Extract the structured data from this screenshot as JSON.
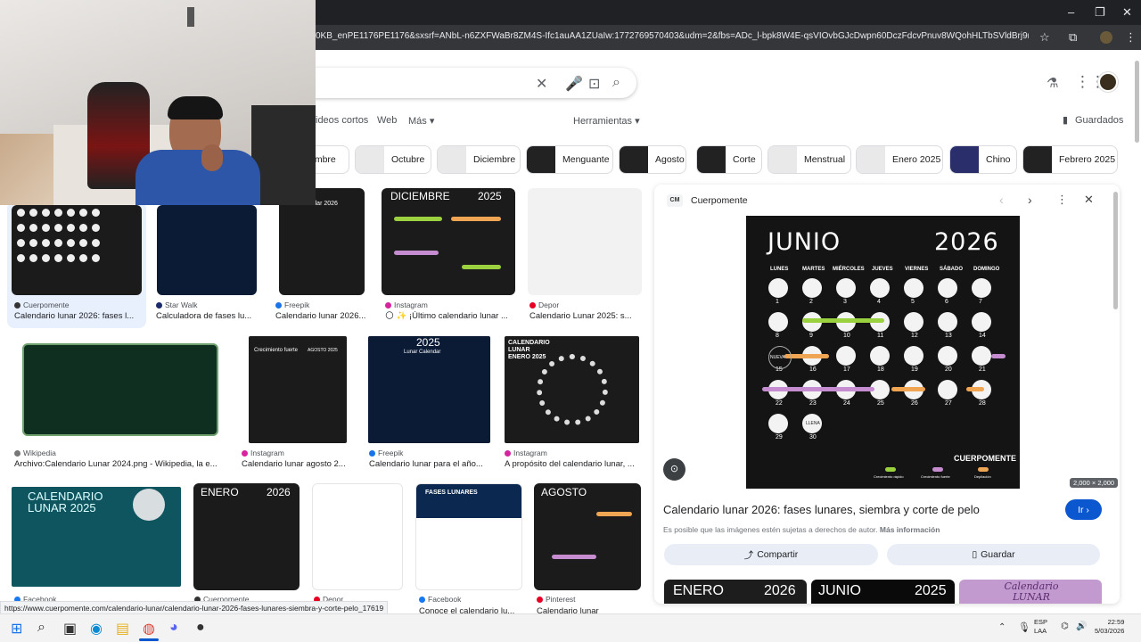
{
  "browser": {
    "url": "0KB_enPE1176PE1176&sxsrf=ANbL-n6ZXFWaBr8ZM4S-Ifc1auAA1ZUaIw:1772769570403&udm=2&fbs=ADc_l-bpk8W4E-qsVIOvbGJcDwpn60DczFdcvPnuv8WQohHLTbSVldBrj9mdwFjfwlgEUgSng...",
    "status_url": "https://www.cuerpomente.com/calendario-lunar/calendario-lunar-2026-fases-lunares-siembra-y-corte-pelo_17619"
  },
  "search": {
    "tabs": [
      "ideos cortos",
      "Web",
      "Más ▾"
    ],
    "tools_label": "Herramientas ▾",
    "saved_label": "Guardados"
  },
  "chips": [
    "embre",
    "Octubre",
    "Diciembre",
    "Menguante",
    "Agosto",
    "Corte",
    "Menstrual",
    "Enero 2025",
    "Chino",
    "Febrero 2025"
  ],
  "results": [
    {
      "source": "Cuerpomente",
      "title": "Calendario lunar 2026: fases l..."
    },
    {
      "source": "Star Walk",
      "title": "Calculadora de fases lu..."
    },
    {
      "source": "Freepik",
      "title": "Calendario lunar 2026..."
    },
    {
      "source": "Instagram",
      "title": "🌕 ✨ ¡Último calendario lunar ..."
    },
    {
      "source": "Depor",
      "title": "Calendario Lunar 2025: s..."
    },
    {
      "source": "Wikipedia",
      "title": "Archivo:Calendario Lunar 2024.png - Wikipedia, la e..."
    },
    {
      "source": "Instagram",
      "title": "Calendario lunar agosto 2..."
    },
    {
      "source": "Freepik",
      "title": "Calendario lunar para el año..."
    },
    {
      "source": "Instagram",
      "title": "A propósito del calendario lunar, ..."
    },
    {
      "source": "Facebook",
      "title": ""
    },
    {
      "source": "Cuerpomente",
      "title": ""
    },
    {
      "source": "Depor",
      "title": "...lunar 20..."
    },
    {
      "source": "Facebook",
      "title": "Conoce el calendario lu..."
    },
    {
      "source": "Pinterest",
      "title": "Calendario lunar"
    }
  ],
  "thumb_text": {
    "diciembre": "DICIEMBRE",
    "diciembre_year": "2025",
    "calendar_2026": "Calendar 2026",
    "crecimiento": "Crecimiento fuerte",
    "agosto_2025": "AGOSTO 2025",
    "lunar_calendar": "2025",
    "lunar_calendar_sub": "Lunar Calendar",
    "enero_2025": "CALENDARIO LUNAR ENERO 2025",
    "cal_lunar_2025": "CALENDARIO LUNAR 2025",
    "enero_2026": "ENERO",
    "enero_2026_year": "2026",
    "fases_lunares": "FASES LUNARES",
    "agosto": "AGOSTO"
  },
  "panel": {
    "source": "Cuerpomente",
    "source_abbr": "CM",
    "title": "Calendario lunar 2026: fases lunares, siembra y corte de pelo",
    "notice": "Es posible que las imágenes estén sujetas a derechos de autor.",
    "more_info": "Más información",
    "go_label": "Ir",
    "share_label": "Compartir",
    "save_label": "Guardar",
    "dimensions": "2,000 × 2,000",
    "related": [
      {
        "month": "ENERO",
        "year": "2026"
      },
      {
        "month": "JUNIO",
        "year": "2025"
      },
      {
        "month": "Calendario LUNAR",
        "year": ""
      }
    ]
  },
  "calendar": {
    "month": "JUNIO",
    "year": "2026",
    "days": [
      "LUNES",
      "MARTES",
      "MIÉRCOLES",
      "JUEVES",
      "VIERNES",
      "SÁBADO",
      "DOMINGO"
    ],
    "numbers": [
      "1",
      "2",
      "3",
      "4",
      "5",
      "6",
      "7",
      "8",
      "9",
      "10",
      "11",
      "12",
      "13",
      "14",
      "15",
      "16",
      "17",
      "18",
      "19",
      "20",
      "21",
      "22",
      "23",
      "24",
      "25",
      "26",
      "27",
      "28",
      "29",
      "30"
    ],
    "new_label": "NUEVA",
    "full_label": "LLENA",
    "brand": "CUERPOMENTE",
    "legend": [
      "Crecimiento rápido",
      "Crecimiento fuerte",
      "Depilación"
    ],
    "colors": {
      "green": "#9bd13f",
      "purple": "#c58ccf",
      "orange": "#f0a552"
    }
  },
  "taskbar": {
    "lang": "ESP",
    "lang2": "LAA",
    "time": "22:59",
    "date": "5/03/2026"
  }
}
